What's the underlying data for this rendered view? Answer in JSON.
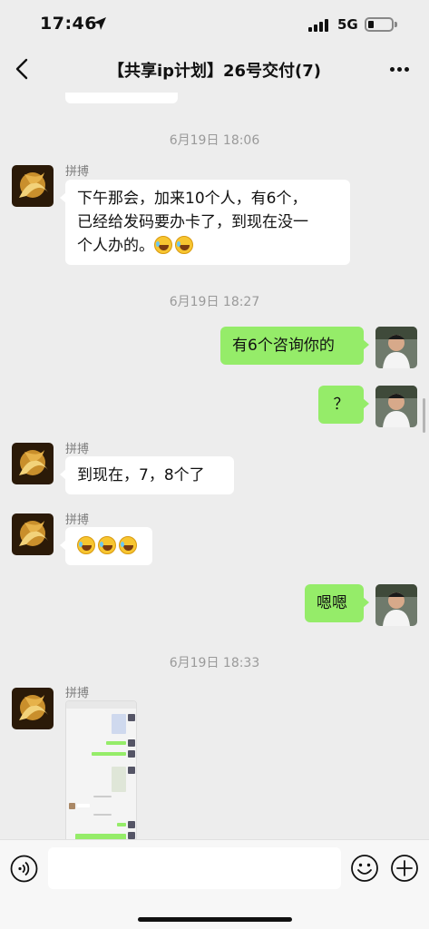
{
  "status_bar": {
    "time": "17:46",
    "network": "5G",
    "location_icon": "location-arrow-icon",
    "signal_icon": "cellular-signal-icon",
    "battery_icon": "battery-icon"
  },
  "nav": {
    "title": "【共享ip计划】26号交付(7)",
    "back_icon": "chevron-left-icon",
    "more_icon": "more-dots-icon"
  },
  "messages": [
    {
      "type": "timestamp",
      "text": "6月19日 18:06"
    },
    {
      "type": "in",
      "sender": "拼搏",
      "lines": [
        "下午那会，加来10个人，有6个，",
        "已经给发码要办卡了，到现在没一",
        "个人办的。"
      ],
      "emoji_count": 2
    },
    {
      "type": "timestamp",
      "text": "6月19日 18:27"
    },
    {
      "type": "out",
      "text": "有6个咨询你的"
    },
    {
      "type": "out",
      "text": "？"
    },
    {
      "type": "in",
      "sender": "拼搏",
      "text": "到现在，7，8个了"
    },
    {
      "type": "in",
      "sender": "拼搏",
      "emoji_count": 3
    },
    {
      "type": "out",
      "text": "嗯嗯"
    },
    {
      "type": "timestamp",
      "text": "6月19日 18:33"
    },
    {
      "type": "in",
      "sender": "拼搏",
      "image": "chat-screenshot-image"
    }
  ],
  "input_bar": {
    "placeholder": "",
    "voice_icon": "voice-icon",
    "emoji_icon": "emoji-icon",
    "plus_icon": "plus-icon"
  },
  "colors": {
    "background": "#ededed",
    "outgoing_bubble": "#95ec69",
    "incoming_bubble": "#ffffff",
    "timestamp_text": "#9a9a9a"
  }
}
